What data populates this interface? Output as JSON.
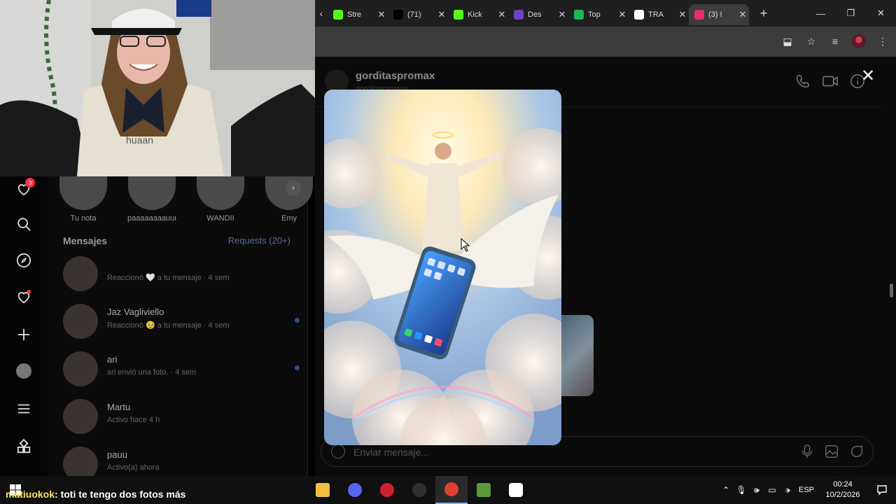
{
  "browser": {
    "tabs": [
      {
        "label": "Stre",
        "icon": "kick-icon",
        "color": "#53fc18",
        "active": false
      },
      {
        "label": "(71)",
        "icon": "tiktok-icon",
        "color": "#000000",
        "active": false
      },
      {
        "label": "Kick",
        "icon": "kick-icon",
        "color": "#53fc18",
        "active": false
      },
      {
        "label": "Des",
        "icon": "twitch-icon",
        "color": "#6f42c1",
        "active": false
      },
      {
        "label": "Top",
        "icon": "spotify-icon",
        "color": "#1db954",
        "active": false
      },
      {
        "label": "TRA",
        "icon": "google-icon",
        "color": "#ffffff",
        "active": false
      },
      {
        "label": "(3) I",
        "icon": "instagram-icon",
        "color": "#e1306c",
        "active": true
      }
    ]
  },
  "instagram": {
    "nav_badge": "3",
    "notes": [
      "Tu nota",
      "paaaaaaaauuuu...",
      "WANDII",
      "Emy"
    ],
    "section_title": "Mensajes",
    "requests_link": "Requests (20+)",
    "conversations": [
      {
        "name": "",
        "preview": "Reaccionó 🤍 a tu mensaje · 4 sem",
        "unread": false
      },
      {
        "name": "Jaz Vagliviello",
        "preview": "Reaccionó 🥹 a tu mensaje · 4 sem",
        "unread": true
      },
      {
        "name": "ari",
        "preview": "ari envió una foto. · 4 sem",
        "unread": true
      },
      {
        "name": "Martu",
        "preview": "Activo hace 4 h",
        "unread": false
      },
      {
        "name": "pauu",
        "preview": "Activo(a) ahora",
        "unread": false
      }
    ],
    "chat": {
      "username": "gorditaspromax",
      "subname": "gorditaspromax",
      "message_placeholder": "Enviar mensaje..."
    }
  },
  "stream_chat": {
    "user": "matiuokok",
    "message": ": toti te tengo dos fotos más"
  },
  "taskbar": {
    "apps": [
      "file-explorer-icon",
      "discord-icon",
      "red-app-icon",
      "obs-icon",
      "chrome-icon",
      "minecraft-icon",
      "capcut-icon"
    ],
    "language": "ESP",
    "time": "00:24",
    "date": "10/2/2026"
  }
}
